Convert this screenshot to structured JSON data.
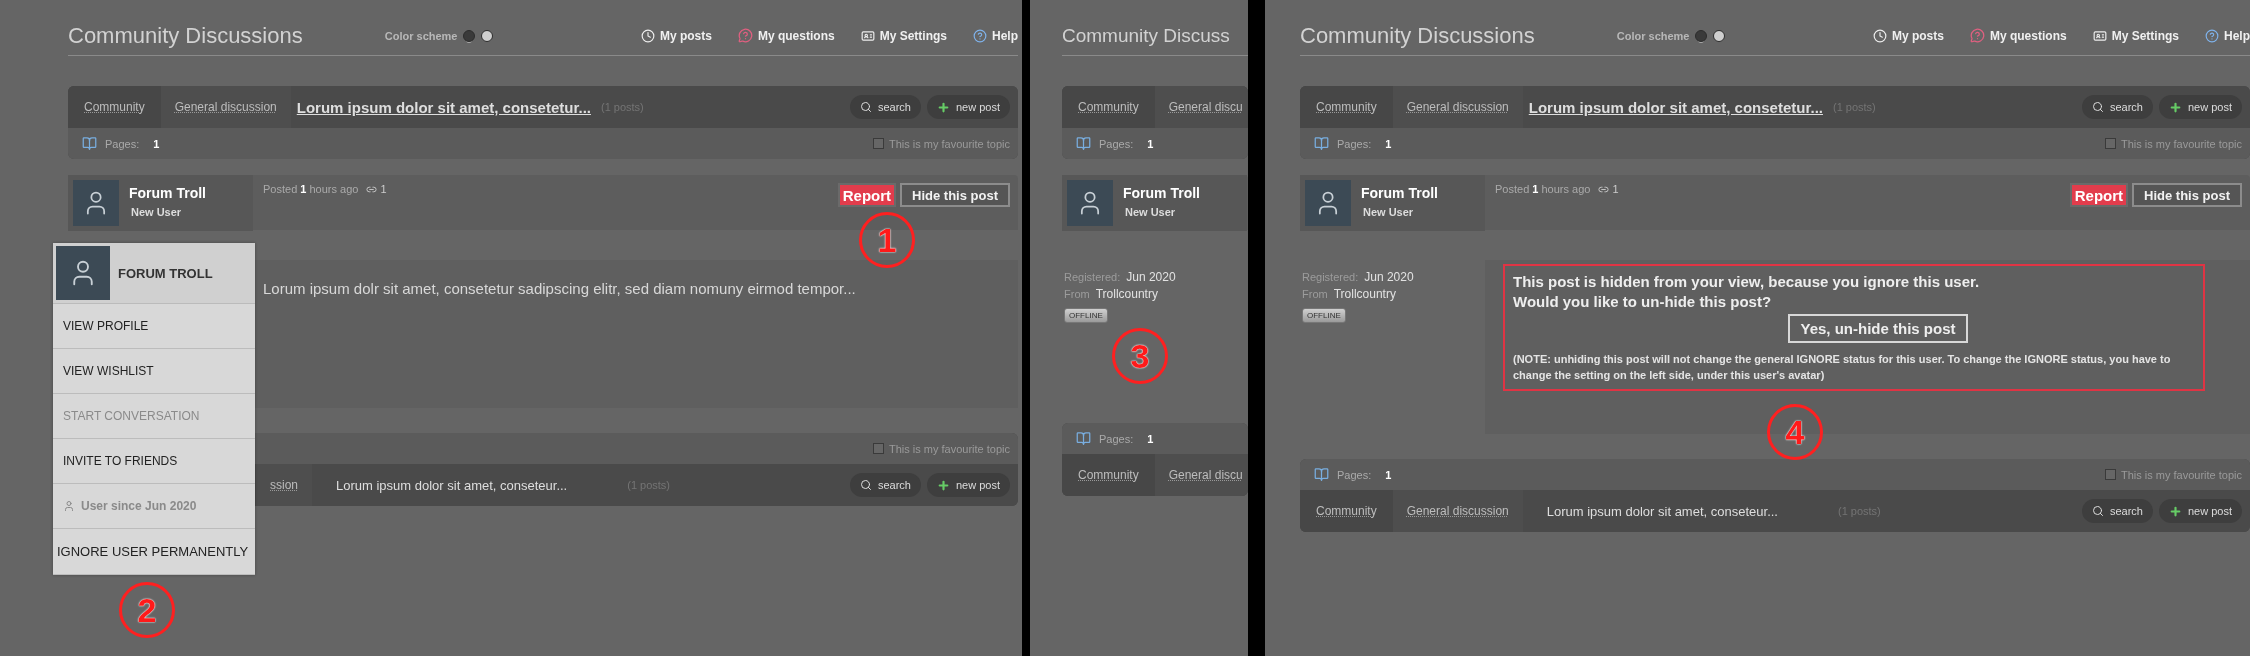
{
  "panels": [
    {
      "header": {
        "title": "Community Discussions",
        "color_scheme": {
          "label": "Color scheme",
          "options": [
            {
              "color": "#3a3a3a",
              "selected": true
            },
            {
              "color": "#cfcfcf",
              "selected": false
            }
          ]
        },
        "nav": [
          {
            "label": "My posts"
          },
          {
            "label": "My questions"
          },
          {
            "label": "My Settings"
          },
          {
            "label": "Help"
          }
        ]
      },
      "topic_bar": {
        "breadcrumbs": [
          "Community",
          "General discussion"
        ],
        "topic": "Lorum ipsum dolor sit amet, consetetur...",
        "post_count": "(1 posts)",
        "search": "search",
        "new_post": "new post",
        "pages_label": "Pages:",
        "pages": "1",
        "favourite": {
          "label": "This is my favourite topic",
          "checked": false
        }
      },
      "post": {
        "author": {
          "name": "Forum Troll",
          "role": "New User"
        },
        "posted": "Posted **1** hours ago",
        "links": "1",
        "report": "Report",
        "hide": "Hide this post",
        "body": {
          "kind": "text",
          "text": "Lorum ipsum dolr sit amet, consetetur sadipscing elitr, sed diam nomuny eirmod tempor..."
        }
      },
      "bottom_bar": {
        "favourite": {
          "label": "This is my favourite topic",
          "checked": false
        },
        "breadcrumbs": [
          "ssion"
        ],
        "topic": "Lorum ipsum dolor sit amet, conseteur...",
        "post_count": "(1 posts)",
        "search": "search",
        "new_post": "new post"
      },
      "user_menu": {
        "title": "FORUM TROLL",
        "items": [
          {
            "kind": "item",
            "label": "VIEW PROFILE",
            "disabled": false
          },
          {
            "kind": "item",
            "label": "VIEW WISHLIST",
            "disabled": false
          },
          {
            "kind": "item",
            "label": "START CONVERSATION",
            "disabled": true
          },
          {
            "kind": "item",
            "label": "INVITE TO FRIENDS",
            "disabled": false
          },
          {
            "kind": "info",
            "label": "User since Jun 2020"
          },
          {
            "kind": "item",
            "label": "IGNORE USER PERMANENTLY",
            "disabled": false
          }
        ]
      },
      "markers": [
        "1",
        "2"
      ]
    },
    {
      "header": {
        "title": "Community Discuss"
      },
      "topic_bar": {
        "breadcrumbs": [
          "Community",
          "General discu"
        ],
        "pages_label": "Pages:",
        "pages": "1"
      },
      "post": {
        "author": {
          "name": "Forum Troll",
          "role": "New User"
        },
        "profile": {
          "registered_label": "Registered:",
          "registered": "Jun 2020",
          "from_label": "From",
          "from": "Trollcountry",
          "status": "OFFLINE"
        }
      },
      "bottom_bar": {
        "pages_label": "Pages:",
        "pages": "1",
        "breadcrumbs": [
          "Community",
          "General discu"
        ]
      },
      "markers": [
        "3"
      ]
    },
    {
      "header": {
        "title": "Community Discussions",
        "color_scheme": {
          "label": "Color scheme",
          "options": [
            {
              "color": "#3a3a3a",
              "selected": true
            },
            {
              "color": "#cfcfcf",
              "selected": false
            }
          ]
        },
        "nav": [
          {
            "label": "My posts"
          },
          {
            "label": "My questions"
          },
          {
            "label": "My Settings"
          },
          {
            "label": "Help"
          }
        ]
      },
      "topic_bar": {
        "breadcrumbs": [
          "Community",
          "General discussion"
        ],
        "topic": "Lorum ipsum dolor sit amet, consetetur...",
        "post_count": "(1 posts)",
        "search": "search",
        "new_post": "new post",
        "pages_label": "Pages:",
        "pages": "1",
        "favourite": {
          "label": "This is my favourite topic",
          "checked": false
        }
      },
      "post": {
        "author": {
          "name": "Forum Troll",
          "role": "New User"
        },
        "posted": "Posted **1** hours ago",
        "links": "1",
        "report": "Report",
        "hide": "Hide this post",
        "profile": {
          "registered_label": "Registered:",
          "registered": "Jun 2020",
          "from_label": "From",
          "from": "Trollcountry",
          "status": "OFFLINE"
        },
        "body": {
          "kind": "hidden_notice",
          "lines": [
            "This post is hidden from your view, because you ignore this user.",
            "Would you like to un-hide this post?"
          ],
          "button": "Yes, un-hide this post",
          "note": "(NOTE: unhiding this post will not change the general IGNORE status for this user. To change the IGNORE status, you have to change the setting on the left side, under this user's avatar)"
        }
      },
      "bottom_bar": {
        "pages_label": "Pages:",
        "pages": "1",
        "favourite": {
          "label": "This is my favourite topic",
          "checked": false
        },
        "breadcrumbs": [
          "Community",
          "General discussion"
        ],
        "topic": "Lorum ipsum dolor sit amet, conseteur...",
        "post_count": "(1 posts)",
        "search": "search",
        "new_post": "new post"
      },
      "markers": [
        "4"
      ]
    }
  ]
}
